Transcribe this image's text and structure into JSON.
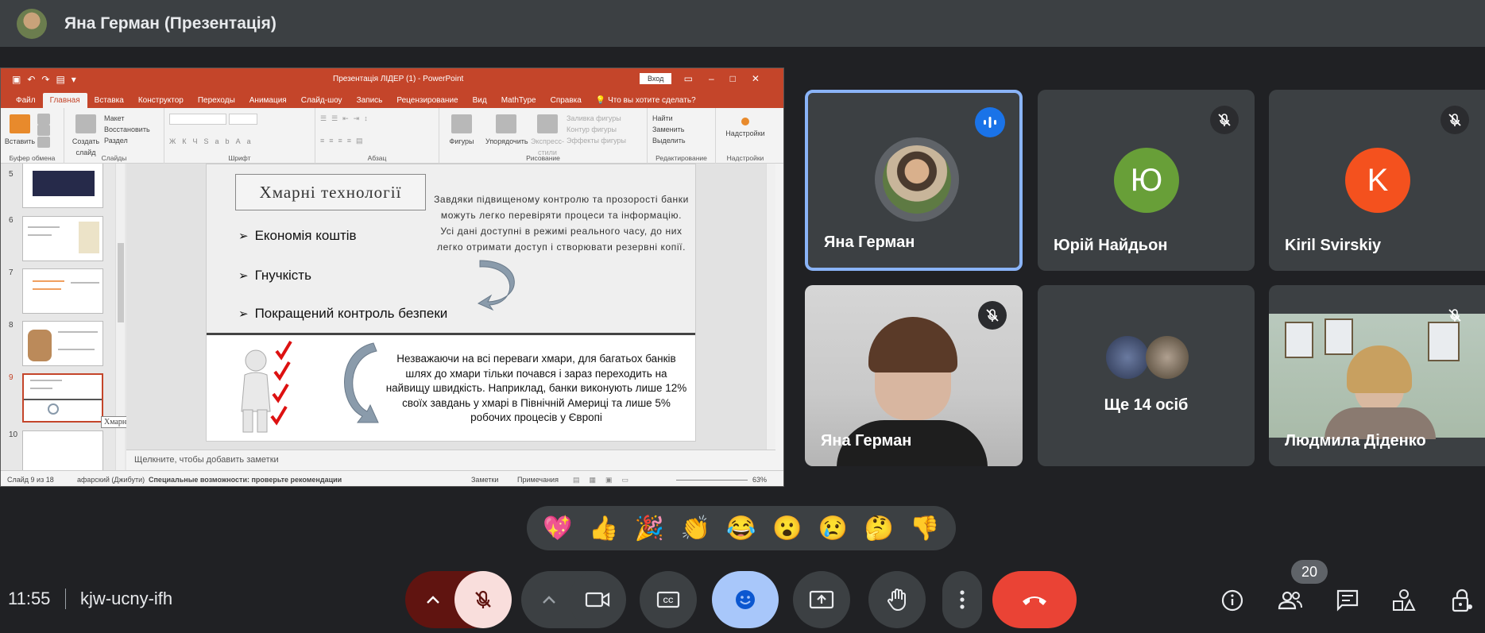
{
  "header": {
    "title": "Яна Герман (Презентація)"
  },
  "ppt": {
    "window_title": "Презентація ЛІДЕР (1)  -  PowerPoint",
    "signin_label": "Вход",
    "tabs": [
      "Файл",
      "Главная",
      "Вставка",
      "Конструктор",
      "Переходы",
      "Анимация",
      "Слайд-шоу",
      "Запись",
      "Рецензирование",
      "Вид",
      "MathType",
      "Справка",
      "Что вы хотите сделать?"
    ],
    "ribbon": {
      "paste": "Вставить",
      "clipboard": "Буфер обмена",
      "new_slide": "Создать слайд",
      "layout": "Макет",
      "reset": "Восстановить",
      "section": "Раздел",
      "slides": "Слайды",
      "font": "Шрифт",
      "paragraph": "Абзац",
      "shapes": "Фигуры",
      "arrange": "Упорядочить",
      "quick_styles": "Экспресс-стили",
      "shape_fill": "Заливка фигуры",
      "shape_outline": "Контур фигуры",
      "shape_effects": "Эффекты фигуры",
      "drawing": "Рисование",
      "find": "Найти",
      "replace": "Заменить",
      "select": "Выделить",
      "editing": "Редактирование",
      "addins_btn": "Надстройки",
      "addins": "Надстройки"
    },
    "thumbnails": [
      "5",
      "6",
      "7",
      "8",
      "9",
      "10"
    ],
    "thumb_tooltip": "Хмарні технології",
    "slide": {
      "title": "Хмарні технології",
      "bullets": [
        "Економія коштів",
        "Гнучкість",
        "Покращений контроль безпеки"
      ],
      "paragraph": "Завдяки підвищеному контролю та прозорості банки можуть легко перевіряти процеси та інформацію. Усі дані доступні в режимі реального часу, до них легко отримати доступ і створювати резервні копії.",
      "note": "Незважаючи на всі переваги хмари, для багатьох банків шлях до хмари тільки почався і зараз переходить на найвищу швидкість. Наприклад, банки виконують лише 12% своїх завдань у хмарі в Північній Америці та лише 5% робочих процесів у Європі"
    },
    "notes_placeholder": "Щелкните, чтобы добавить заметки",
    "status": {
      "slide_of": "Слайд 9 из 18",
      "language": "афарский (Джибути)",
      "accessibility": "Специальные возможности: проверьте рекомендации",
      "notes": "Заметки",
      "comments": "Примечания",
      "zoom": "63%"
    }
  },
  "participants": [
    {
      "name": "Яна Герман",
      "state": "speaking"
    },
    {
      "name": "Юрій Найдьон",
      "initial": "Ю",
      "color": "#689f38",
      "state": "muted"
    },
    {
      "name": "Kiril Svirskiy",
      "initial": "K",
      "color": "#f4511e",
      "state": "muted"
    },
    {
      "name": "Яна Герман",
      "state": "muted"
    },
    {
      "name": "Ще 14 осіб"
    },
    {
      "name": "Людмила Діденко",
      "state": "muted"
    }
  ],
  "reactions": [
    "💖",
    "👍",
    "🎉",
    "👏",
    "😂",
    "😮",
    "😢",
    "🤔",
    "👎"
  ],
  "bottom": {
    "time": "11:55",
    "meeting_code": "kjw-ucny-ifh",
    "participants_count": "20"
  },
  "colors": {
    "bg": "#202124",
    "tile": "#3c4043",
    "end_call": "#ea4335",
    "active": "#8ab4f8",
    "ppt_accent": "#c4452a"
  }
}
